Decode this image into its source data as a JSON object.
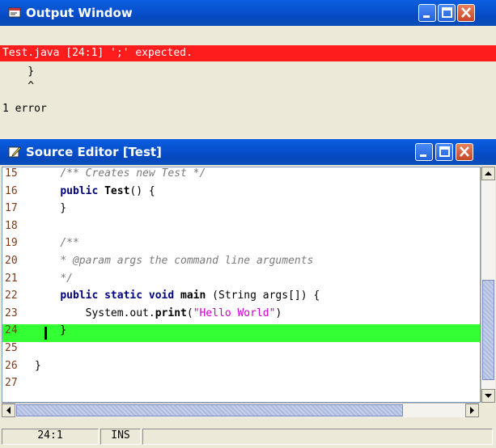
{
  "output_window": {
    "title": "Output Window",
    "error_line": "Test.java [24:1] ';' expected.",
    "lines": [
      "    }",
      "    ^",
      "1 error"
    ]
  },
  "source_editor": {
    "title": "Source Editor [Test]",
    "lines": [
      {
        "n": "15",
        "code": [
          {
            "t": "    "
          },
          {
            "t": "/** Creates new Test */",
            "c": "cm"
          }
        ]
      },
      {
        "n": "16",
        "code": [
          {
            "t": "    "
          },
          {
            "t": "public",
            "c": "kw"
          },
          {
            "t": " "
          },
          {
            "t": "Test",
            "c": "b"
          },
          {
            "t": "() {"
          }
        ]
      },
      {
        "n": "17",
        "code": [
          {
            "t": "    }"
          }
        ]
      },
      {
        "n": "18",
        "code": []
      },
      {
        "n": "19",
        "code": [
          {
            "t": "    "
          },
          {
            "t": "/**",
            "c": "cm"
          }
        ]
      },
      {
        "n": "20",
        "code": [
          {
            "t": "    "
          },
          {
            "t": "* @param args the command line arguments",
            "c": "cm"
          }
        ]
      },
      {
        "n": "21",
        "code": [
          {
            "t": "    "
          },
          {
            "t": "*/",
            "c": "cm"
          }
        ]
      },
      {
        "n": "22",
        "code": [
          {
            "t": "    "
          },
          {
            "t": "public static void",
            "c": "kw"
          },
          {
            "t": " "
          },
          {
            "t": "main",
            "c": "b"
          },
          {
            "t": " (String args[]) {"
          }
        ]
      },
      {
        "n": "23",
        "code": [
          {
            "t": "        System.out."
          },
          {
            "t": "print",
            "c": "b"
          },
          {
            "t": "("
          },
          {
            "t": "\"Hello World\"",
            "c": "str"
          },
          {
            "t": ")"
          }
        ]
      },
      {
        "n": "24",
        "code": [
          {
            "t": "    }"
          }
        ],
        "highlight": true
      },
      {
        "n": "25",
        "code": []
      },
      {
        "n": "26",
        "code": [
          {
            "t": "}"
          }
        ]
      },
      {
        "n": "27",
        "code": []
      }
    ],
    "status": {
      "position": "24:1",
      "mode": "INS"
    }
  },
  "colors": {
    "error_bar": "#ff1c1c",
    "current_line": "#33ff33",
    "title_bar": "#0852d0"
  }
}
